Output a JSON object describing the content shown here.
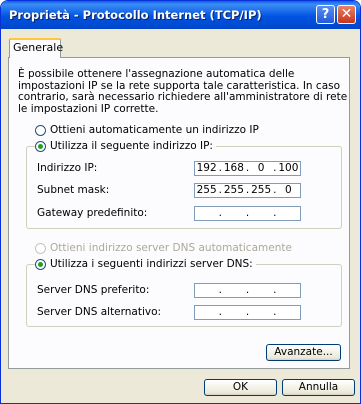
{
  "window": {
    "title": "Proprietà - Protocollo Internet (TCP/IP)",
    "help_label": "?",
    "close_label": "✕"
  },
  "tabs": [
    {
      "label": "Generale"
    }
  ],
  "description": "È possibile ottenere l'assegnazione automatica delle impostazioni IP se la rete supporta tale caratteristica. In caso contrario, sarà necessario richiedere all'amministratore di rete le impostazioni IP corrette.",
  "ip_options": {
    "auto_label": "Ottieni automaticamente un indirizzo IP",
    "manual_label": "Utilizza il seguente indirizzo IP:",
    "selected": "manual"
  },
  "ip_fields": [
    {
      "label": "Indirizzo IP:",
      "octets": [
        "192",
        "168",
        "0",
        "100"
      ]
    },
    {
      "label": "Subnet mask:",
      "octets": [
        "255",
        "255",
        "255",
        "0"
      ]
    },
    {
      "label": "Gateway predefinito:",
      "octets": [
        "",
        "",
        "",
        ""
      ]
    }
  ],
  "dns_options": {
    "auto_label": "Ottieni indirizzo server DNS automaticamente",
    "manual_label": "Utilizza i seguenti indirizzi server DNS:",
    "selected": "manual",
    "auto_disabled": true
  },
  "dns_fields": [
    {
      "label": "Server DNS preferito:",
      "octets": [
        "",
        "",
        "",
        ""
      ]
    },
    {
      "label": "Server DNS alternativo:",
      "octets": [
        "",
        "",
        "",
        ""
      ]
    }
  ],
  "buttons": {
    "advanced": "Avanzate...",
    "ok": "OK",
    "cancel": "Annulla"
  },
  "colors": {
    "titlebar": "#0054e3",
    "radio_dot": "#21a121",
    "tab_highlight": "#ffc83c"
  }
}
